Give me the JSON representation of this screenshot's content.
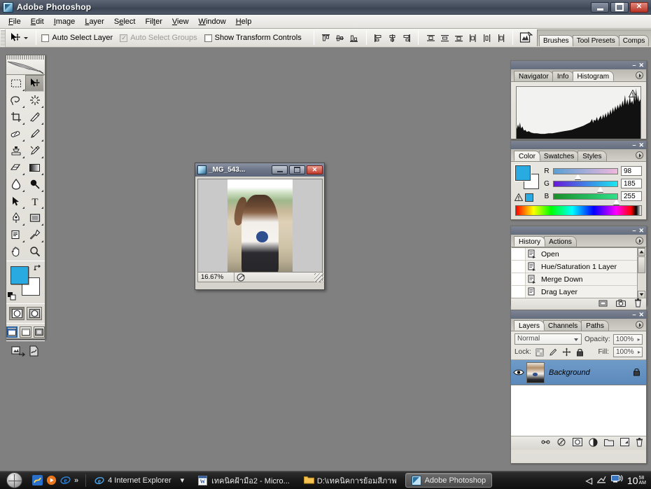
{
  "window": {
    "title": "Adobe Photoshop",
    "app_icon": "photoshop-icon",
    "buttons": {
      "minimize": "minimize-icon",
      "maximize": "maximize-icon",
      "close": "close-icon"
    }
  },
  "menubar": {
    "items": [
      {
        "label": "File",
        "accel": "F"
      },
      {
        "label": "Edit",
        "accel": "E"
      },
      {
        "label": "Image",
        "accel": "I"
      },
      {
        "label": "Layer",
        "accel": "L"
      },
      {
        "label": "Select",
        "accel": "S"
      },
      {
        "label": "Filter",
        "accel": "t"
      },
      {
        "label": "View",
        "accel": "V"
      },
      {
        "label": "Window",
        "accel": "W"
      },
      {
        "label": "Help",
        "accel": "H"
      }
    ]
  },
  "options_bar": {
    "active_tool": "move-tool",
    "checkboxes": [
      {
        "label": "Auto Select Layer",
        "checked": false,
        "enabled": true
      },
      {
        "label": "Auto Select Groups",
        "checked": true,
        "enabled": false
      },
      {
        "label": "Show Transform Controls",
        "checked": false,
        "enabled": true
      }
    ],
    "align_buttons": [
      "align-top-edges",
      "align-vertical-centers",
      "align-bottom-edges",
      "align-left-edges",
      "align-horizontal-centers",
      "align-right-edges"
    ],
    "distribute_buttons": [
      "distribute-top-edges",
      "distribute-vertical-centers",
      "distribute-bottom-edges",
      "distribute-left-edges",
      "distribute-horizontal-centers",
      "distribute-right-edges"
    ],
    "palette_well": {
      "icon": "image-ready-jump-icon",
      "tabs": [
        {
          "label": "Brushes",
          "selected": true
        },
        {
          "label": "Tool Presets",
          "selected": false
        },
        {
          "label": "Comps",
          "selected": false
        }
      ]
    }
  },
  "toolbox": {
    "tools": [
      {
        "name": "rectangular-marquee-tool",
        "active": false,
        "has_flyout": true
      },
      {
        "name": "move-tool",
        "active": true,
        "has_flyout": false
      },
      {
        "name": "lasso-tool",
        "active": false,
        "has_flyout": true
      },
      {
        "name": "magic-wand-tool",
        "active": false,
        "has_flyout": true
      },
      {
        "name": "crop-tool",
        "active": false,
        "has_flyout": true
      },
      {
        "name": "slice-tool",
        "active": false,
        "has_flyout": true
      },
      {
        "name": "healing-brush-tool",
        "active": false,
        "has_flyout": true
      },
      {
        "name": "brush-tool",
        "active": false,
        "has_flyout": true
      },
      {
        "name": "clone-stamp-tool",
        "active": false,
        "has_flyout": true
      },
      {
        "name": "history-brush-tool",
        "active": false,
        "has_flyout": true
      },
      {
        "name": "eraser-tool",
        "active": false,
        "has_flyout": true
      },
      {
        "name": "gradient-tool",
        "active": false,
        "has_flyout": true
      },
      {
        "name": "blur-tool",
        "active": false,
        "has_flyout": true
      },
      {
        "name": "dodge-tool",
        "active": false,
        "has_flyout": true
      },
      {
        "name": "path-selection-tool",
        "active": false,
        "has_flyout": true
      },
      {
        "name": "type-tool",
        "active": false,
        "has_flyout": true
      },
      {
        "name": "pen-tool",
        "active": false,
        "has_flyout": true
      },
      {
        "name": "rectangle-shape-tool",
        "active": false,
        "has_flyout": true
      },
      {
        "name": "notes-tool",
        "active": false,
        "has_flyout": true
      },
      {
        "name": "eyedropper-tool",
        "active": false,
        "has_flyout": true
      },
      {
        "name": "hand-tool",
        "active": false,
        "has_flyout": false
      },
      {
        "name": "zoom-tool",
        "active": false,
        "has_flyout": false
      }
    ],
    "foreground_color": "#29aae1",
    "background_color": "#ffffff",
    "swap_colors": "swap-colors-icon",
    "default_colors": "default-colors-icon",
    "mask_modes": [
      {
        "name": "standard-mask-mode",
        "selected": true
      },
      {
        "name": "quick-mask-mode",
        "selected": false
      }
    ],
    "screen_modes": [
      {
        "name": "standard-screen-mode",
        "selected": true
      },
      {
        "name": "full-screen-with-menubar-mode",
        "selected": false
      },
      {
        "name": "full-screen-mode",
        "selected": false
      }
    ],
    "jump_to": "jump-to-imageready-icon"
  },
  "document": {
    "title": "_MG_543...",
    "icon": "photoshop-document-icon",
    "zoom": "16.67%",
    "status_icon": "doc-info-icon",
    "buttons": {
      "minimize": "minimize-icon",
      "maximize": "maximize-icon",
      "close": "close-icon"
    },
    "resize_grip": "resize-grip-icon"
  },
  "palettes": {
    "histogram": {
      "tabs": [
        {
          "label": "Navigator",
          "selected": false
        },
        {
          "label": "Info",
          "selected": false
        },
        {
          "label": "Histogram",
          "selected": true
        }
      ],
      "warning_icon": "cached-data-warning-icon",
      "menu_icon": "palette-menu-icon"
    },
    "color": {
      "tabs": [
        {
          "label": "Color",
          "selected": true
        },
        {
          "label": "Swatches",
          "selected": false
        },
        {
          "label": "Styles",
          "selected": false
        }
      ],
      "menu_icon": "palette-menu-icon",
      "foreground_color": "#29aae1",
      "background_color": "#ffffff",
      "gamut_warning_icon": "out-of-gamut-warning-icon",
      "channels": [
        {
          "label": "R",
          "value": "98",
          "percent": 38
        },
        {
          "label": "G",
          "value": "185",
          "percent": 73
        },
        {
          "label": "B",
          "value": "255",
          "percent": 100
        }
      ]
    },
    "history": {
      "tabs": [
        {
          "label": "History",
          "selected": true
        },
        {
          "label": "Actions",
          "selected": false
        }
      ],
      "menu_icon": "palette-menu-icon",
      "states": [
        {
          "label": "Open",
          "icon": "history-state-icon"
        },
        {
          "label": "Hue/Saturation 1 Layer",
          "icon": "history-state-icon"
        },
        {
          "label": "Merge Down",
          "icon": "history-state-icon"
        },
        {
          "label": "Drag Layer",
          "icon": "history-state-icon"
        }
      ],
      "footer_buttons": [
        "create-document-from-state-icon",
        "create-new-snapshot-icon",
        "delete-state-icon"
      ]
    },
    "layers": {
      "tabs": [
        {
          "label": "Layers",
          "selected": true
        },
        {
          "label": "Channels",
          "selected": false
        },
        {
          "label": "Paths",
          "selected": false
        }
      ],
      "menu_icon": "palette-menu-icon",
      "blend_mode": "Normal",
      "opacity_label": "Opacity:",
      "opacity_value": "100%",
      "lock_label": "Lock:",
      "fill_label": "Fill:",
      "fill_value": "100%",
      "lock_buttons": [
        "lock-transparent-pixels-icon",
        "lock-image-pixels-icon",
        "lock-position-icon",
        "lock-all-icon"
      ],
      "rows": [
        {
          "name": "Background",
          "visible": true,
          "locked": true,
          "selected": true
        }
      ],
      "footer_buttons": [
        "link-layers-icon",
        "layer-style-icon",
        "add-layer-mask-icon",
        "new-adjustment-layer-icon",
        "new-group-icon",
        "new-layer-icon",
        "delete-layer-icon"
      ]
    }
  },
  "taskbar": {
    "start_button": "start-orb-icon",
    "quicklaunch": [
      {
        "name": "show-desktop-icon"
      },
      {
        "name": "media-player-icon"
      },
      {
        "name": "internet-explorer-icon"
      },
      {
        "name": "more-chevron-icon",
        "label": "»"
      }
    ],
    "tasks": [
      {
        "label": "4 Internet Explorer",
        "icon": "internet-explorer-icon",
        "active": false,
        "group": true
      },
      {
        "label": "เทคนิคฝ้ามือ2 - Micro...",
        "icon": "word-icon",
        "active": false
      },
      {
        "label": "D:\\เทคนิคการย้อมสีภาพ",
        "icon": "folder-icon",
        "active": false
      },
      {
        "label": "Adobe Photoshop",
        "icon": "photoshop-icon",
        "active": true
      }
    ],
    "tray": {
      "expand_icon": "tray-expand-chevron-icon",
      "icons": [
        "network-activity-icon",
        "display-icon"
      ],
      "clock_time": "10",
      "clock_minutes": "58",
      "clock_ampm": "AM"
    }
  }
}
